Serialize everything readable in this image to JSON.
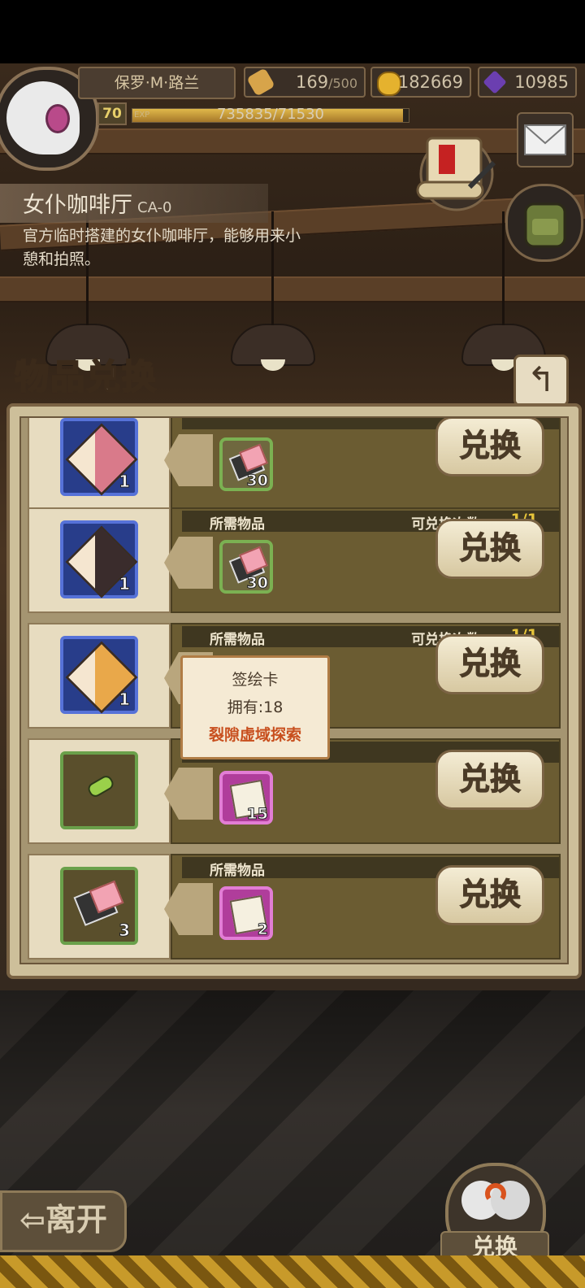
{
  "player": {
    "name": "保罗·M·路兰",
    "level": "70",
    "exp_tag": "EXP",
    "exp_text": "735835/71530",
    "exp_fraction": 0.98,
    "stamina": "169",
    "stamina_max": "/500",
    "gold": "182669",
    "gems": "10985"
  },
  "location": {
    "title": "女仆咖啡厅",
    "code": "CA-0",
    "description": "官方临时搭建的女仆咖啡厅，能够用来小憩和拍照。"
  },
  "panel": {
    "title": "物品兑换",
    "back_icon": "↰"
  },
  "rows": [
    {
      "reward_type": "character-puzzle",
      "reward_qty": "1",
      "req_type": "card-pack",
      "req_qty": "30",
      "button": "兑换",
      "header_label": "",
      "count_label": "",
      "count": ""
    },
    {
      "reward_type": "character-puzzle",
      "reward_qty": "1",
      "req_type": "card-pack",
      "req_qty": "30",
      "button": "兑换",
      "header_label": "所需物品",
      "count_label": "可兑换次数:",
      "count": "1/1"
    },
    {
      "reward_type": "character-puzzle",
      "reward_qty": "1",
      "req_type": "card-pack",
      "req_qty": "",
      "button": "兑换",
      "header_label": "所需物品",
      "count_label": "可兑换次数:",
      "count": "1/1"
    },
    {
      "reward_type": "green-item",
      "reward_qty": "",
      "req_type": "sign-card",
      "req_qty": "15",
      "button": "兑换",
      "header_label": "",
      "count_label": "",
      "count": ""
    },
    {
      "reward_type": "card-pack",
      "reward_qty": "3",
      "req_type": "sign-card",
      "req_qty": "2",
      "button": "兑换",
      "header_label": "所需物品",
      "count_label": "",
      "count": ""
    }
  ],
  "tooltip": {
    "name": "签绘卡",
    "owned": "拥有:18",
    "source": "裂隙虚域探索"
  },
  "bottom": {
    "leave": "离开",
    "exchange": "兑换"
  },
  "colors": {
    "accent_gold": "#e6c43a",
    "source_text": "#c84f1e",
    "slot_blue": "#5672d8",
    "slot_green": "#6aa04a",
    "slot_pink": "#e27dd5"
  }
}
